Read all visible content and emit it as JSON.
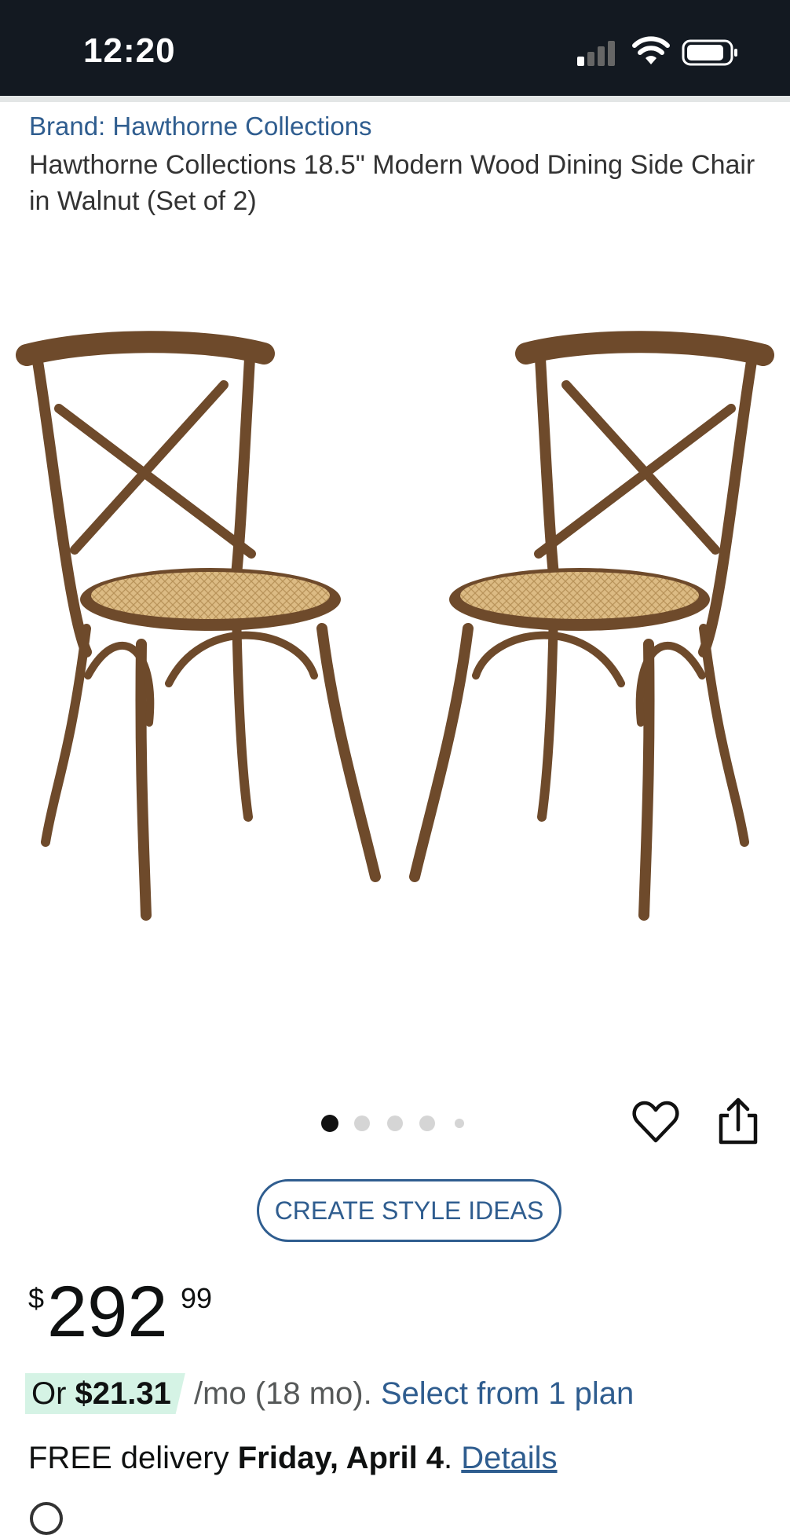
{
  "status": {
    "time": "12:20"
  },
  "brand": {
    "label": "Brand: Hawthorne Collections"
  },
  "product": {
    "title": "Hawthorne Collections 18.5\" Modern Wood Dining Side Chair in Walnut (Set of 2)"
  },
  "carousel": {
    "count": 5,
    "active": 0
  },
  "actions": {
    "wishlist_icon": "heart-icon",
    "share_icon": "share-icon"
  },
  "style_ideas": {
    "label": "CREATE STYLE IDEAS"
  },
  "price": {
    "symbol": "$",
    "whole": "292",
    "fraction": "99"
  },
  "financing": {
    "or": "Or ",
    "amount": "$21.31",
    "term": " /mo (18 mo). ",
    "link": "Select from 1 plan"
  },
  "delivery": {
    "prefix": "FREE delivery ",
    "date": "Friday, April 4",
    "sep": ". ",
    "link": "Details"
  },
  "colors": {
    "header_bg": "#131921",
    "link": "#2f5d8f",
    "financing_highlight": "#d5f3e5",
    "wood": "#7a5230",
    "rattan": "#d9b77e"
  }
}
